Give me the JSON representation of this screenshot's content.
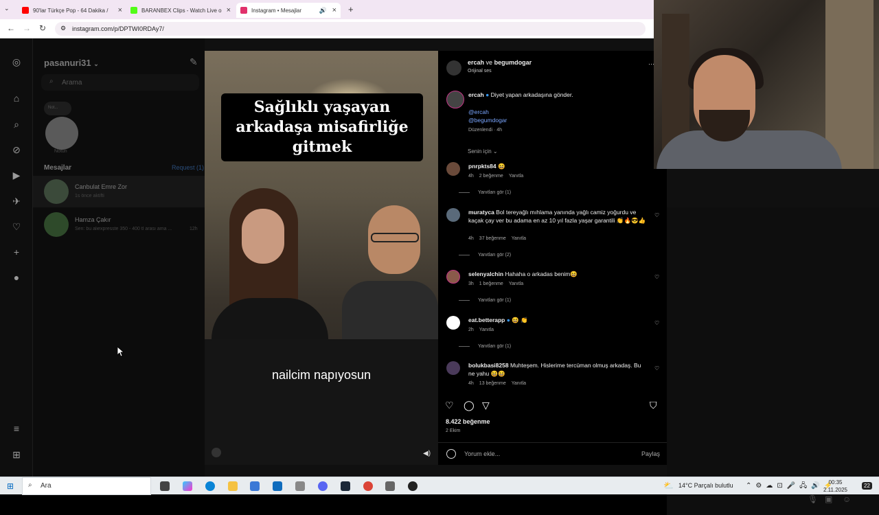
{
  "browser": {
    "tabs": [
      {
        "label": "90'lar Türkçe Pop - 64 Dakika /",
        "color": "#ff0000"
      },
      {
        "label": "BARANBEX Clips - Watch Live o",
        "color": "#53fc18"
      },
      {
        "label": "Instagram • Mesajlar",
        "color": "#e1306c"
      }
    ],
    "new_tab": "+",
    "url": "instagram.com/p/DPTWI0RDAy7/"
  },
  "dm": {
    "username": "pasanuri31",
    "search_placeholder": "Arama",
    "note_bubble": "Not...",
    "note_label": "Notun",
    "messages_title": "Mesajlar",
    "requests": "Request (1)",
    "conversations": [
      {
        "name": "Canbulat Emre Zor",
        "sub": "1s önce aktifti"
      },
      {
        "name": "Hamza Çakır",
        "sub": "Sen: bu aliexpresste 350 - 400 tl arası ama ...",
        "time": "12h"
      }
    ]
  },
  "video": {
    "caption": "Sağlıklı yaşayan arkadaşa misafirliğe gitmek",
    "subtitle": "nailcim napıyosun"
  },
  "post": {
    "header_user": "ercah",
    "header_and": "ve",
    "header_collab": "begumdogar",
    "header_audio": "Orijinal ses",
    "more": "···",
    "caption_user": "ercah",
    "caption_text": "Diyet yapan arkadaşına gönder.",
    "mention1": "@ercah",
    "mention2": "@begumdogar",
    "edited": "Düzenlendi · 4h",
    "sort": "Senin için",
    "comments": [
      {
        "user": "pnrpkts84",
        "text": "😆",
        "time": "4h",
        "likes": "2 beğenme",
        "reply": "Yanıtla",
        "replies": "Yanıtları gör (1)"
      },
      {
        "user": "muratyca",
        "text": "Bol tereyağlı mıhlama yanında yağlı camiz yoğurdu ve kaçak çay ver bu adama en az 10 yıl fazla yaşar garantili 👏🔥😎👍",
        "time": "4h",
        "likes": "37 beğenme",
        "reply": "Yanıtla",
        "replies": "Yanıtları gör (2)"
      },
      {
        "user": "selenyalchin",
        "text": "Hahaha o arkadas benim😆",
        "time": "3h",
        "likes": "1 beğenme",
        "reply": "Yanıtla",
        "replies": "Yanıtları gör (1)"
      },
      {
        "user": "eat.betterapp",
        "text": "😆 👏",
        "time": "2h",
        "likes": "",
        "reply": "Yanıtla",
        "replies": "Yanıtları gör (1)"
      },
      {
        "user": "bolukbasi8258",
        "text": "Muhteşem. Hislerime tercüman olmuş arkadaş. Bu ne yahu 😆😆",
        "time": "4h",
        "likes": "13 beğenme",
        "reply": "Yanıtla",
        "replies": ""
      }
    ],
    "likes_total": "8.422 beğenme",
    "date": "2 Ekim",
    "comment_placeholder": "Yorum ekle...",
    "share": "Paylaş"
  },
  "taskbar": {
    "search": "Ara",
    "weather": "14°C  Parçalı bulutlu",
    "time": "00:35",
    "date": "2.11.2025",
    "notif": "22"
  }
}
